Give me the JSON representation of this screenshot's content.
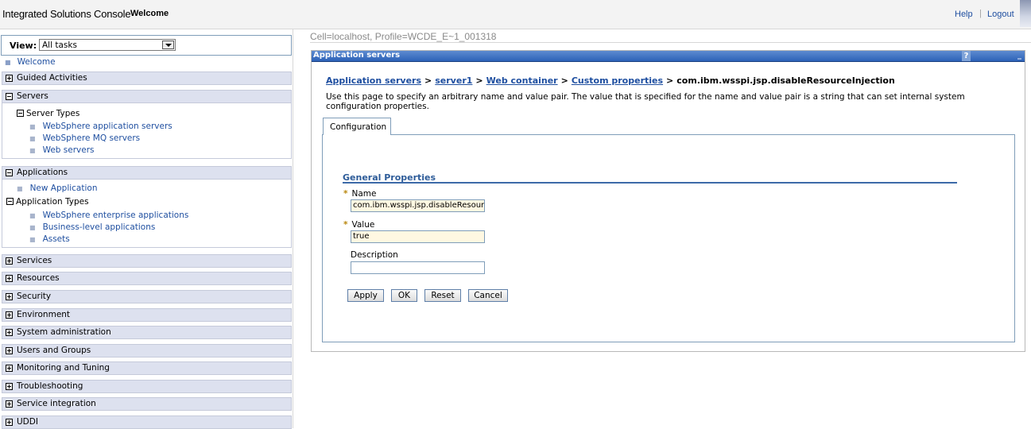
{
  "banner": {
    "app_title": "Integrated Solutions Console",
    "welcome": "Welcome",
    "help": "Help",
    "separator": "|",
    "logout": "Logout"
  },
  "nav": {
    "view_label": "View:",
    "view_value": "All tasks",
    "welcome_link": "Welcome",
    "categories": {
      "guided": "Guided Activities",
      "servers": "Servers",
      "applications": "Applications",
      "services": "Services",
      "resources": "Resources",
      "security": "Security",
      "environment": "Environment",
      "sysadmin": "System administration",
      "users": "Users and Groups",
      "monitoring": "Monitoring and Tuning",
      "troubleshooting": "Troubleshooting",
      "service_integration": "Service integration",
      "uddi": "UDDI"
    },
    "servers": {
      "group": "Server Types",
      "items": [
        "WebSphere application servers",
        "WebSphere MQ servers",
        "Web servers"
      ]
    },
    "applications": {
      "new_app": "New Application",
      "group": "Application Types",
      "items": [
        "WebSphere enterprise applications",
        "Business-level applications",
        "Assets"
      ]
    }
  },
  "main": {
    "cell_info": "Cell=localhost, Profile=WCDE_E~1_001318",
    "portlet_title": "Application servers",
    "help_icon": "?",
    "minimize_icon": "_",
    "breadcrumb": {
      "items": [
        "Application servers",
        "server1",
        "Web container",
        "Custom properties"
      ],
      "current": "com.ibm.wsspi.jsp.disableResourceInjection",
      "separator": ">"
    },
    "description": "Use this page to specify an arbitrary name and value pair. The value that is specified for the name and value pair is a string that can set internal system configuration properties.",
    "tab": "Configuration",
    "general_properties": "General Properties",
    "required_marker": "*",
    "name_label": "Name",
    "name_value": "com.ibm.wsspi.jsp.disableResourceInjection",
    "value_label": "Value",
    "value_value": "true",
    "description_label": "Description",
    "description_value": "",
    "buttons": {
      "apply": "Apply",
      "ok": "OK",
      "reset": "Reset",
      "cancel": "Cancel"
    }
  },
  "colors": {
    "link": "#1f4fa0",
    "titlebar": "#2d62b8",
    "nav_category_bg": "#dde1ef",
    "required_field_bg": "#fff8e2"
  }
}
